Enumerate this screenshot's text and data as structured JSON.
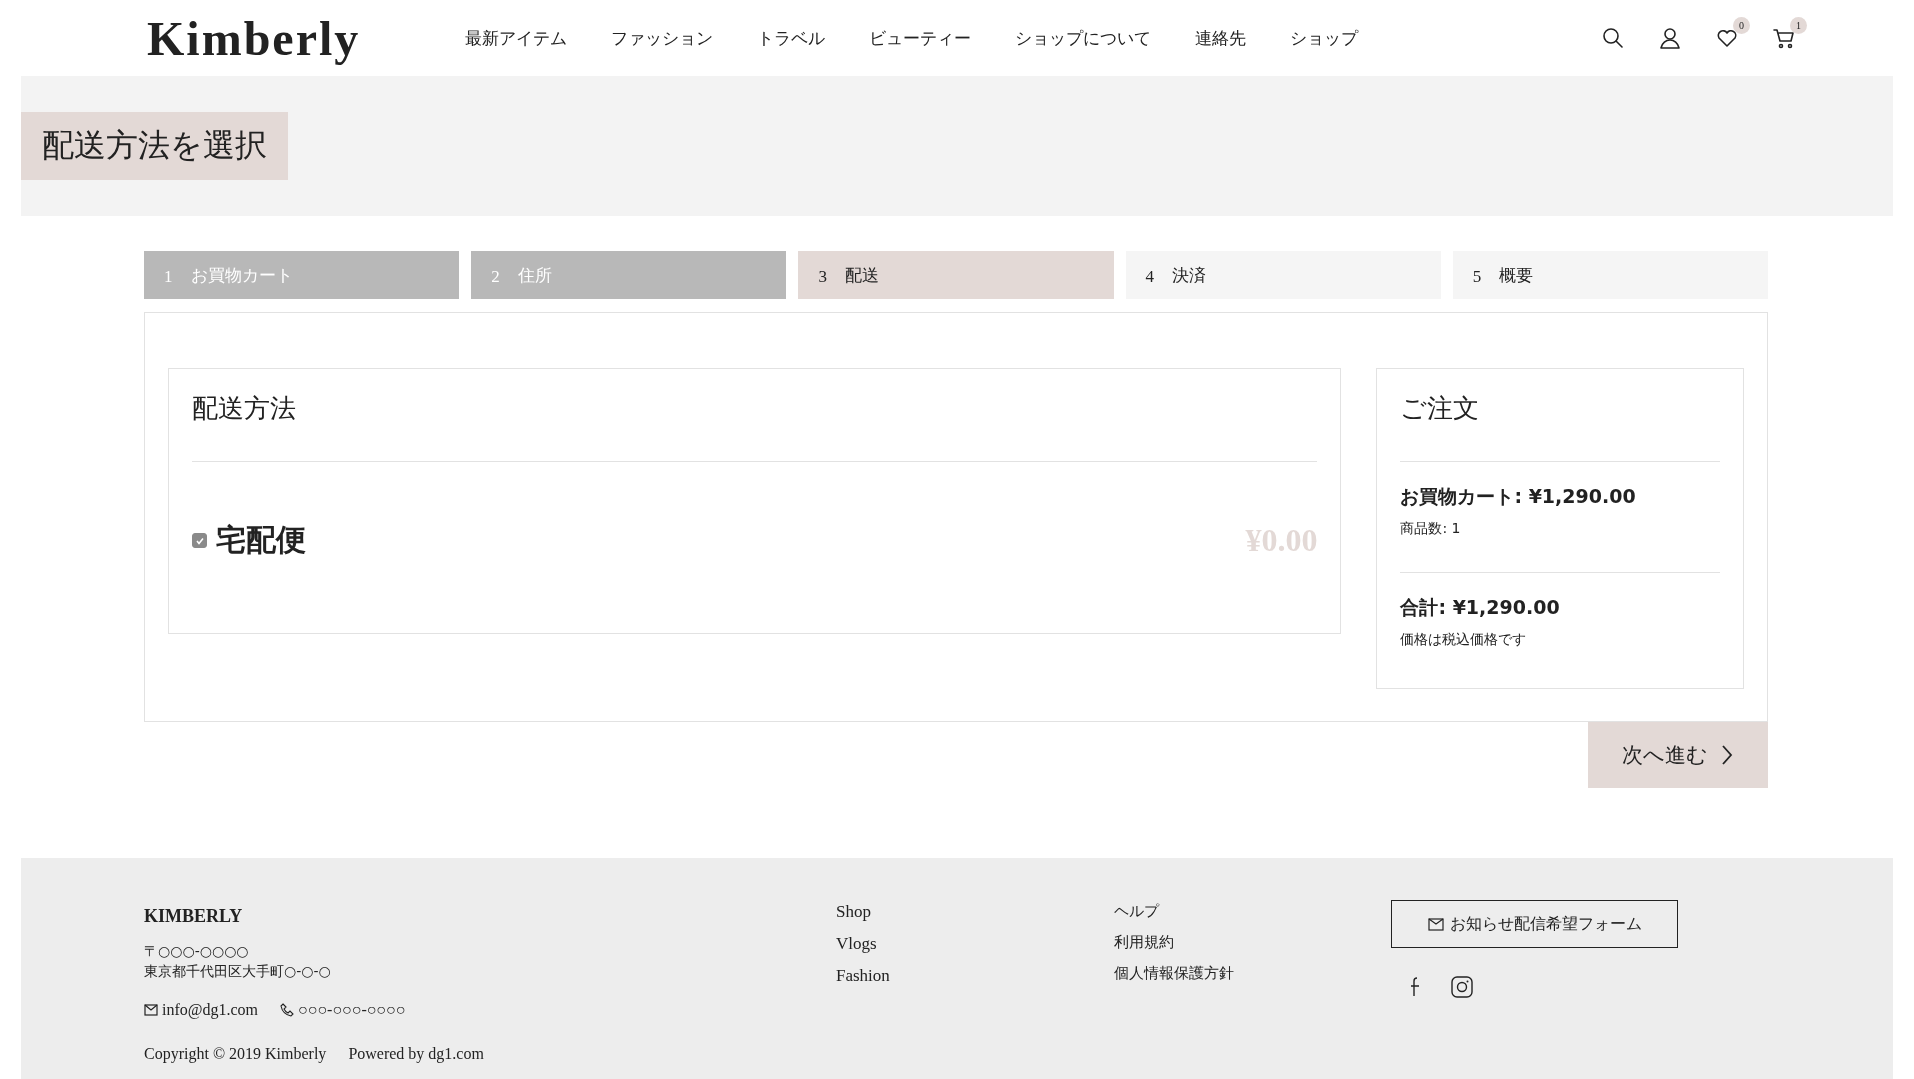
{
  "header": {
    "logo": "Kimberly",
    "nav": [
      "最新アイテム",
      "ファッション",
      "トラベル",
      "ビューティー",
      "ショップについて",
      "連絡先",
      "ショップ"
    ],
    "wishlist_count": "0",
    "cart_count": "1"
  },
  "page_title": "配送方法を選択",
  "steps": [
    {
      "number": "1",
      "label": "お買物カート",
      "kind": "done",
      "selected": false
    },
    {
      "number": "2",
      "label": "住所",
      "kind": "done",
      "selected": false
    },
    {
      "number": "3",
      "label": "配送",
      "kind": "todo",
      "selected": true
    },
    {
      "number": "4",
      "label": "決済",
      "kind": "todo",
      "selected": false
    },
    {
      "number": "5",
      "label": "概要",
      "kind": "todo",
      "selected": false
    }
  ],
  "shipping": {
    "title": "配送方法",
    "options": [
      {
        "name": "宅配便",
        "price": "¥0.00",
        "checked": true
      }
    ]
  },
  "order": {
    "title": "ご注文",
    "cart_total": "お買物カート: ¥1,290.00",
    "item_count": "商品数: 1",
    "total": "合計: ¥1,290.00",
    "tax_note": "価格は税込価格です"
  },
  "next_button": "次へ進む",
  "footer": {
    "brand": "KIMBERLY",
    "postal": "〒○○○-○○○○",
    "address": "東京都千代田区大手町○-○-○",
    "email": "info@dg1.com",
    "phone": "○○○-○○○-○○○○",
    "links_1": [
      "Shop",
      "Vlogs",
      "Fashion"
    ],
    "links_2": [
      "ヘルプ",
      "利用規約",
      "個人情報保護方針"
    ],
    "newsletter_button": "お知らせ配信希望フォーム",
    "copyright": "Copyright © 2019 Kimberly",
    "powered": "Powered by dg1.com"
  }
}
